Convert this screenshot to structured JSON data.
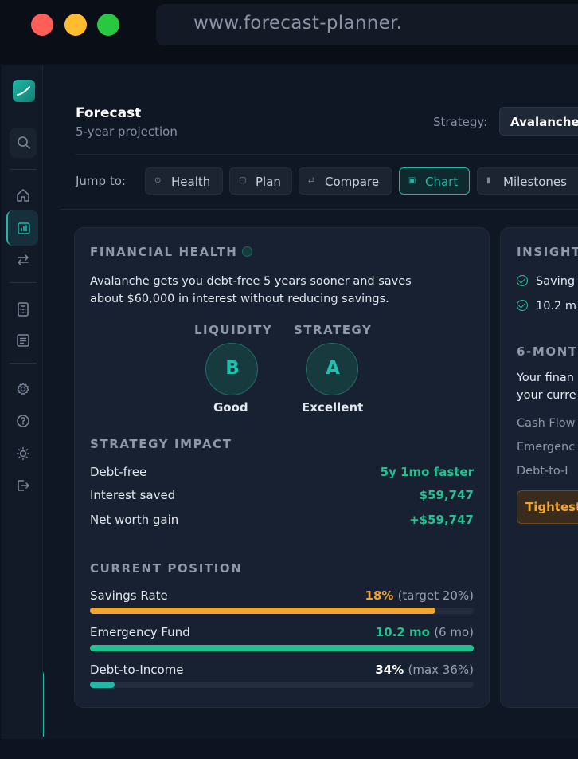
{
  "browser": {
    "url": "www.forecast-planner."
  },
  "page": {
    "title": "Forecast",
    "subtitle": "5-year projection",
    "strategy_label": "Strategy:",
    "strategy_value": "Avalanche"
  },
  "jump": {
    "label": "Jump to:",
    "buttons": [
      {
        "label": "Health",
        "icon": "health-icon"
      },
      {
        "label": "Plan",
        "icon": "plan-icon"
      },
      {
        "label": "Compare",
        "icon": "compare-icon"
      },
      {
        "label": "Chart",
        "icon": "chart-icon",
        "active": true
      },
      {
        "label": "Milestones",
        "icon": "milestones-icon"
      }
    ]
  },
  "health": {
    "heading": "FINANCIAL HEALTH",
    "summary_line1": "Avalanche gets you debt-free 5 years sooner and saves",
    "summary_line2": "about $60,000 in interest without reducing savings.",
    "grades": [
      {
        "label": "LIQUIDITY",
        "grade": "B",
        "word": "Good"
      },
      {
        "label": "STRATEGY",
        "grade": "A",
        "word": "Excellent"
      }
    ],
    "impact_heading": "STRATEGY IMPACT",
    "impact": [
      {
        "label": "Debt-free",
        "value": "5y 1mo faster"
      },
      {
        "label": "Interest saved",
        "value": "$59,747"
      },
      {
        "label": "Net worth gain",
        "value": "+$59,747"
      }
    ],
    "position_heading": "CURRENT POSITION",
    "position": [
      {
        "label": "Savings Rate",
        "value": "18%",
        "note": "(target 20%)",
        "fill": 0.9,
        "color": "#f0a431"
      },
      {
        "label": "Emergency Fund",
        "value": "10.2 mo",
        "note": "(6 mo)",
        "fill": 1.0,
        "color": "#21c28f"
      },
      {
        "label": "Debt-to-Income",
        "value": "34%",
        "note": "(max 36%)",
        "fill": 0.065,
        "color": "#1fb8a6"
      }
    ]
  },
  "insights": {
    "heading": "INSIGHTS",
    "items": [
      "Saving",
      "10.2 m"
    ],
    "six_month_heading": "6-MONT",
    "six_month_line1": "Your finan",
    "six_month_line2": "your curre",
    "rows": [
      "Cash Flow",
      "Emergenc",
      "Debt-to-I"
    ],
    "tight_label": "Tightest"
  },
  "colors": {
    "accent": "#1fb8a6",
    "positive": "#21c28f",
    "warning": "#f0a431"
  }
}
